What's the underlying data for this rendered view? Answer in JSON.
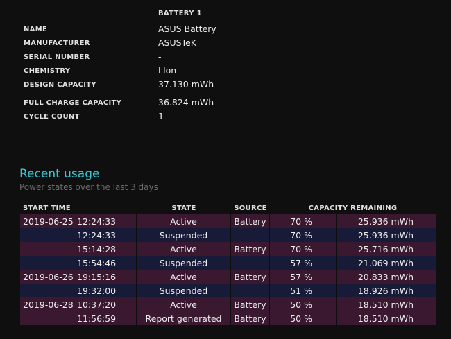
{
  "battery": {
    "header": "BATTERY 1",
    "rows": [
      {
        "label": "NAME",
        "value": "ASUS Battery"
      },
      {
        "label": "MANUFACTURER",
        "value": "ASUSTeK"
      },
      {
        "label": "SERIAL NUMBER",
        "value": "-"
      },
      {
        "label": "CHEMISTRY",
        "value": "LIon"
      },
      {
        "label": "DESIGN CAPACITY",
        "value": "37.130 mWh"
      },
      {
        "label": "FULL CHARGE CAPACITY",
        "value": "36.824 mWh"
      },
      {
        "label": "CYCLE COUNT",
        "value": "1"
      }
    ]
  },
  "recent_usage": {
    "title": "Recent usage",
    "subtitle": "Power states over the last 3 days",
    "columns": {
      "start_time": "START TIME",
      "state": "STATE",
      "source": "SOURCE",
      "capacity": "CAPACITY REMAINING"
    },
    "rows": [
      {
        "date": "2019-06-25",
        "time": "12:24:33",
        "state": "Active",
        "source": "Battery",
        "pct": "70 %",
        "mwh": "25.936 mWh"
      },
      {
        "date": "",
        "time": "12:24:33",
        "state": "Suspended",
        "source": "",
        "pct": "70 %",
        "mwh": "25.936 mWh"
      },
      {
        "date": "",
        "time": "15:14:28",
        "state": "Active",
        "source": "Battery",
        "pct": "70 %",
        "mwh": "25.716 mWh"
      },
      {
        "date": "",
        "time": "15:54:46",
        "state": "Suspended",
        "source": "",
        "pct": "57 %",
        "mwh": "21.069 mWh"
      },
      {
        "date": "2019-06-26",
        "time": "19:15:16",
        "state": "Active",
        "source": "Battery",
        "pct": "57 %",
        "mwh": "20.833 mWh"
      },
      {
        "date": "",
        "time": "19:32:00",
        "state": "Suspended",
        "source": "",
        "pct": "51 %",
        "mwh": "18.926 mWh"
      },
      {
        "date": "2019-06-28",
        "time": "10:37:20",
        "state": "Active",
        "source": "Battery",
        "pct": "50 %",
        "mwh": "18.510 mWh"
      },
      {
        "date": "",
        "time": "11:56:59",
        "state": "Report generated",
        "source": "Battery",
        "pct": "50 %",
        "mwh": "18.510 mWh"
      }
    ]
  },
  "colors": {
    "background": "#0f0f0f",
    "accent": "#38c9d4",
    "row_odd": "#3a1830",
    "row_even": "#181b38"
  }
}
